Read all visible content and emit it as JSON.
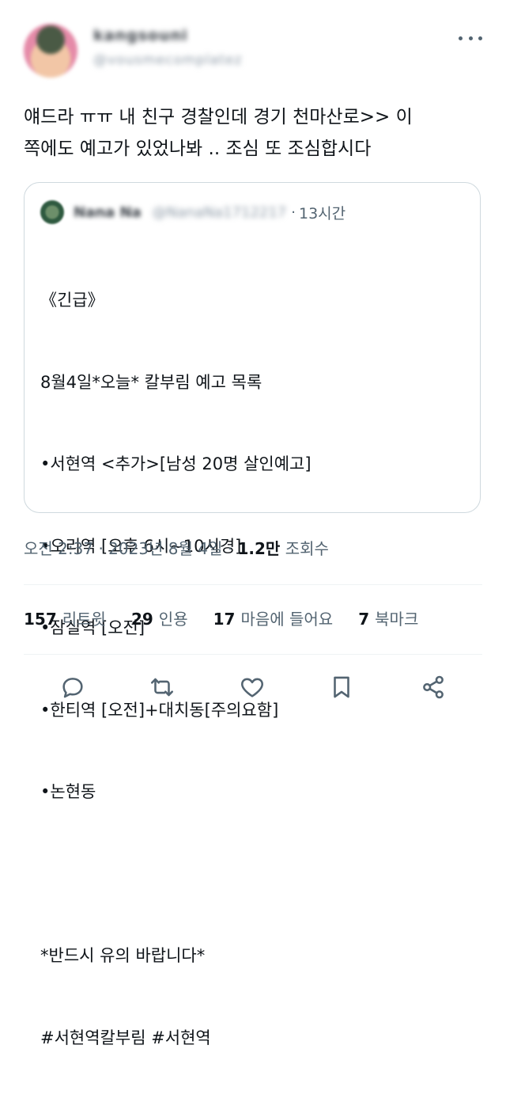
{
  "author": {
    "display_name": "kangsouni",
    "handle": "@vousmecomplatez"
  },
  "tweet": {
    "text": "얘드라 ㅠㅠ 내 친구 경찰인데 경기 천마산로>> 이\n쪽에도 예고가 있었나봐 .. 조심 또 조심합시다"
  },
  "quote": {
    "display_name": "Nana Na",
    "handle": "@NanaNa1712217",
    "separator": "·",
    "time": "13시간",
    "lines": [
      "《긴급》",
      "8월4일*오늘* 칼부림 예고 목록",
      "•서현역 <추가>[남성 20명 살인예고]",
      "•오리역 [오후 6시~10시경]",
      "•잠실역 [오전]",
      "•한티역 [오전]+대치동[주의요함]",
      "•논현동",
      "",
      "*반드시 유의 바랍니다*",
      "#서현역칼부림 #서현역"
    ]
  },
  "meta": {
    "time": "오전 2:37",
    "date": "2023년 8월 4일",
    "sep": "·",
    "views_value": "1.2만",
    "views_label": "조회수"
  },
  "stats": {
    "retweets_value": "157",
    "retweets_label": "리트윗",
    "quotes_value": "29",
    "quotes_label": "인용",
    "likes_value": "17",
    "likes_label": "마음에 들어요",
    "bookmarks_value": "7",
    "bookmarks_label": "북마크"
  },
  "actions": [
    "reply-icon",
    "retweet-icon",
    "like-icon",
    "bookmark-icon",
    "share-icon"
  ],
  "colors": {
    "text": "#0f1419",
    "secondary": "#536471",
    "border": "#cfd9de"
  }
}
